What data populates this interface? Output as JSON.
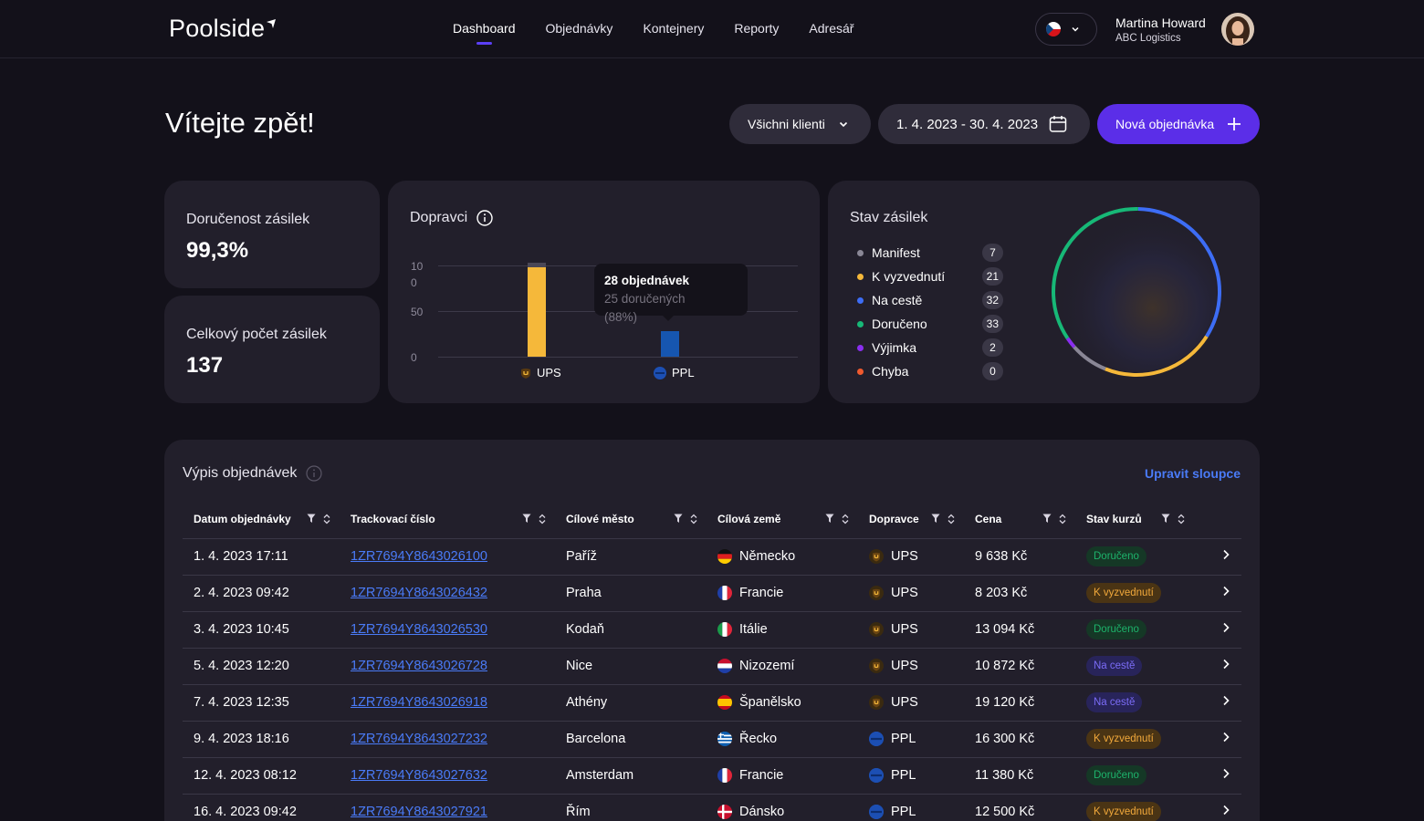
{
  "app": {
    "logo": "Poolside"
  },
  "nav": {
    "items": [
      "Dashboard",
      "Objednávky",
      "Kontejnery",
      "Reporty",
      "Adresář"
    ],
    "active": "Dashboard"
  },
  "user": {
    "name": "Martina Howard",
    "company": "ABC Logistics",
    "language_flag": "cz-flag-icon"
  },
  "header": {
    "welcome": "Vítejte zpět!",
    "clients_filter": "Všichni klienti",
    "date_range": "1. 4. 2023 - 30. 4. 2023",
    "new_order": "Nová objednávka"
  },
  "kpis": [
    {
      "label": "Doručenost zásilek",
      "value": "99,3%"
    },
    {
      "label": "Celkový počet zásilek",
      "value": "137"
    }
  ],
  "carriers_card": {
    "title": "Dopravci",
    "tooltip": {
      "line1": "28 objednávek",
      "line2": "25 doručených",
      "line3": "(88%)"
    }
  },
  "chart_data": {
    "type": "bar",
    "categories": [
      "UPS",
      "PPL"
    ],
    "series": [
      {
        "values": [
          103,
          28
        ],
        "colors": [
          "#f5b83a",
          "#1656b0"
        ]
      }
    ],
    "ylim": [
      0,
      100
    ],
    "yticks": [
      "0",
      "50",
      "10\n0"
    ],
    "y_tick_values": [
      0,
      50,
      100
    ],
    "grid": true
  },
  "status_card": {
    "title": "Stav zásilek",
    "items": [
      {
        "label": "Manifest",
        "count": "7",
        "color": "#8a8796"
      },
      {
        "label": "K vyzvednutí",
        "count": "21",
        "color": "#f5b83a"
      },
      {
        "label": "Na cestě",
        "count": "32",
        "color": "#3d6df5"
      },
      {
        "label": "Doručeno",
        "count": "33",
        "color": "#17b877"
      },
      {
        "label": "Výjimka",
        "count": "2",
        "color": "#8a2ef0"
      },
      {
        "label": "Chyba",
        "count": "0",
        "color": "#f05a2e"
      }
    ]
  },
  "orders": {
    "title": "Výpis objednávek",
    "edit_columns": "Upravit sloupce",
    "columns": [
      "Datum objednávky",
      "Trackovací číslo",
      "Cílové město",
      "Cílová země",
      "Dopravce",
      "Cena",
      "Stav kurzů"
    ],
    "rows": [
      {
        "date": "1. 4. 2023 17:11",
        "tracking": "1ZR7694Y8643026100",
        "city": "Paříž",
        "country": "Německo",
        "flag": "de",
        "carrier": "UPS",
        "price": "9 638 Kč",
        "status": "Doručeno",
        "status_type": "delivered"
      },
      {
        "date": "2. 4. 2023 09:42",
        "tracking": "1ZR7694Y8643026432",
        "city": "Praha",
        "country": "Francie",
        "flag": "fr",
        "carrier": "UPS",
        "price": "8 203 Kč",
        "status": "K vyzvednutí",
        "status_type": "pickup"
      },
      {
        "date": "3. 4. 2023 10:45",
        "tracking": "1ZR7694Y8643026530",
        "city": "Kodaň",
        "country": "Itálie",
        "flag": "it",
        "carrier": "UPS",
        "price": "13 094 Kč",
        "status": "Doručeno",
        "status_type": "delivered"
      },
      {
        "date": "5. 4. 2023 12:20",
        "tracking": "1ZR7694Y8643026728",
        "city": "Nice",
        "country": "Nizozemí",
        "flag": "nl",
        "carrier": "UPS",
        "price": "10 872 Kč",
        "status": "Na cestě",
        "status_type": "transit"
      },
      {
        "date": "7. 4. 2023 12:35",
        "tracking": "1ZR7694Y8643026918",
        "city": "Athény",
        "country": "Španělsko",
        "flag": "es",
        "carrier": "UPS",
        "price": "19 120 Kč",
        "status": "Na cestě",
        "status_type": "transit"
      },
      {
        "date": "9. 4. 2023 18:16",
        "tracking": "1ZR7694Y8643027232",
        "city": "Barcelona",
        "country": "Řecko",
        "flag": "gr",
        "carrier": "PPL",
        "price": "16 300 Kč",
        "status": "K vyzvednutí",
        "status_type": "pickup"
      },
      {
        "date": "12. 4. 2023 08:12",
        "tracking": "1ZR7694Y8643027632",
        "city": "Amsterdam",
        "country": "Francie",
        "flag": "fr",
        "carrier": "PPL",
        "price": "11 380 Kč",
        "status": "Doručeno",
        "status_type": "delivered"
      },
      {
        "date": "16. 4. 2023 09:42",
        "tracking": "1ZR7694Y8643027921",
        "city": "Řím",
        "country": "Dánsko",
        "flag": "dk",
        "carrier": "PPL",
        "price": "12 500 Kč",
        "status": "K vyzvednutí",
        "status_type": "pickup"
      }
    ]
  }
}
